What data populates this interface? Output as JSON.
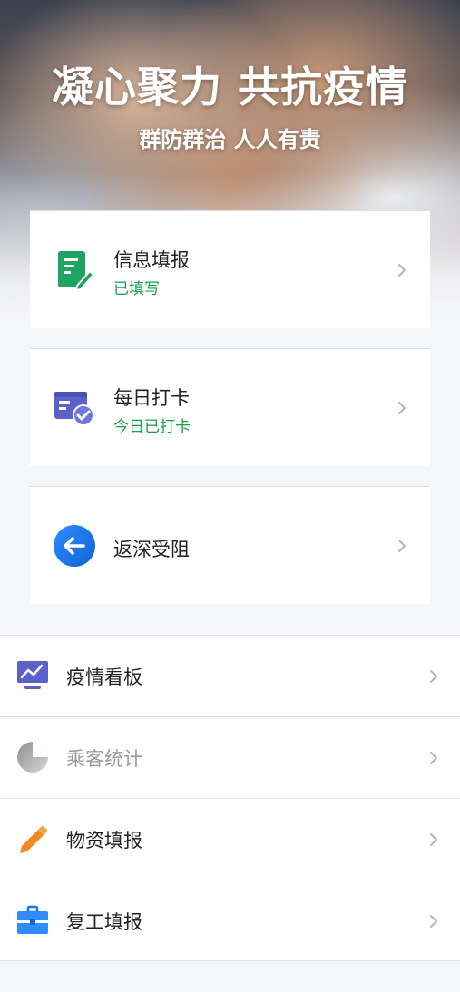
{
  "hero": {
    "title": "凝心聚力 共抗疫情",
    "subtitle": "群防群治 人人有责"
  },
  "cards": [
    {
      "label": "信息填报",
      "status": "已填写",
      "icon": "form-edit-icon",
      "color": "#1fa363"
    },
    {
      "label": "每日打卡",
      "status": "今日已打卡",
      "icon": "checkin-icon",
      "color": "#5a61c9"
    },
    {
      "label": "返深受阻",
      "status": "",
      "icon": "back-arrow-icon",
      "color": "#1677e8"
    }
  ],
  "menu": [
    {
      "label": "疫情看板",
      "icon": "dashboard-icon",
      "color": "#5a61c9",
      "disabled": false
    },
    {
      "label": "乘客统计",
      "icon": "pie-chart-icon",
      "color": "#a9a9a9",
      "disabled": true
    },
    {
      "label": "物资填报",
      "icon": "pencil-icon",
      "color": "#f08a24",
      "disabled": false
    },
    {
      "label": "复工填报",
      "icon": "briefcase-icon",
      "color": "#1677e8",
      "disabled": false
    }
  ],
  "colors": {
    "status_green": "#14a04a",
    "chevron": "#b5b8be",
    "background": "#f5f6f8"
  }
}
